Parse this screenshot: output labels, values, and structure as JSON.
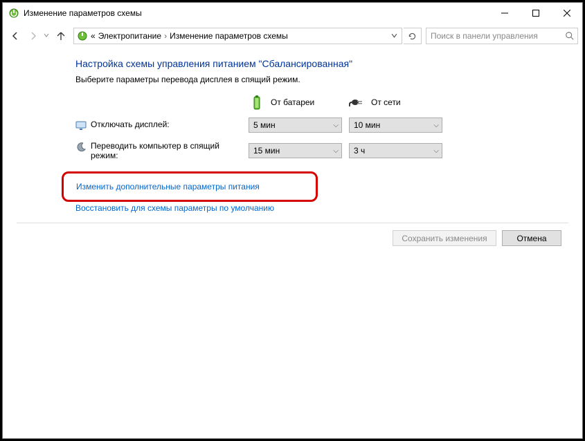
{
  "window": {
    "title": "Изменение параметров схемы"
  },
  "nav": {
    "crumb_prefix": "«",
    "crumb1": "Электропитание",
    "crumb2": "Изменение параметров схемы",
    "search_placeholder": "Поиск в панели управления"
  },
  "page": {
    "title": "Настройка схемы управления питанием \"Сбалансированная\"",
    "subtitle": "Выберите параметры перевода дисплея в спящий режим."
  },
  "columns": {
    "battery": "От батареи",
    "ac": "От сети"
  },
  "rows": {
    "display_off": {
      "label": "Отключать дисплей:",
      "battery_value": "5 мин",
      "ac_value": "10 мин"
    },
    "sleep": {
      "label": "Переводить компьютер в спящий режим:",
      "battery_value": "15 мин",
      "ac_value": "3 ч"
    }
  },
  "links": {
    "advanced": "Изменить дополнительные параметры питания",
    "restore": "Восстановить для схемы параметры по умолчанию"
  },
  "buttons": {
    "save": "Сохранить изменения",
    "cancel": "Отмена"
  }
}
